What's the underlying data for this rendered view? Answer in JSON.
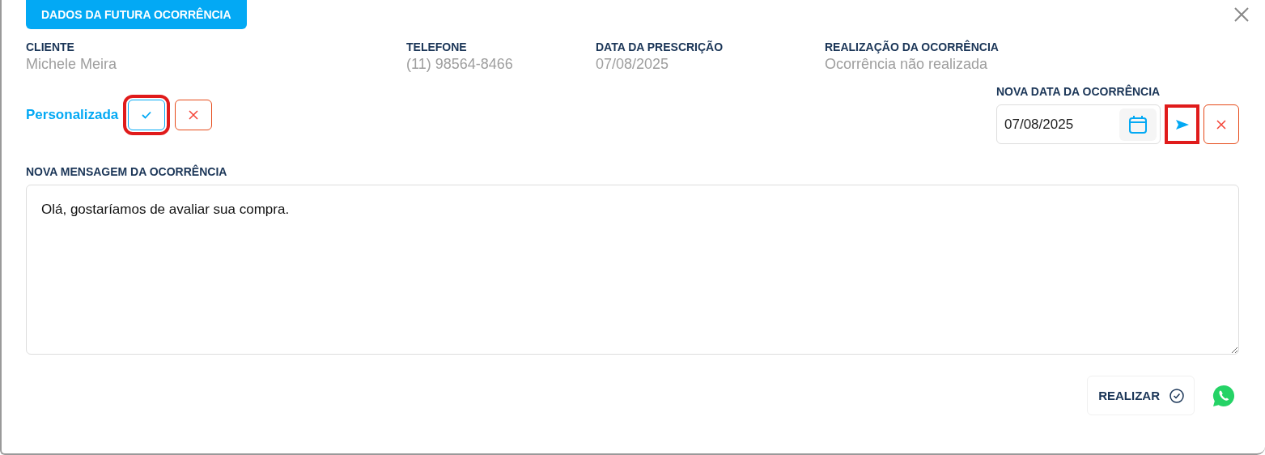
{
  "header_tab": {
    "label": "DADOS DA FUTURA OCORRÊNCIA"
  },
  "info": [
    {
      "label": "CLIENTE",
      "value": "Michele Meira"
    },
    {
      "label": "TELEFONE",
      "value": "(11) 98564-8466"
    },
    {
      "label": "DATA DA PRESCRIÇÃO",
      "value": "07/08/2025"
    },
    {
      "label": "REALIZAÇÃO DA OCORRÊNCIA",
      "value": "Ocorrência não realizada"
    }
  ],
  "personalizada": {
    "label": "Personalizada",
    "confirm_highlighted": true
  },
  "nova_data": {
    "label": "NOVA DATA DA OCORRÊNCIA",
    "value": "07/08/2025",
    "send_highlighted": true
  },
  "mensagem": {
    "label": "NOVA MENSAGEM DA OCORRÊNCIA",
    "value": "Olá, gostaríamos de avaliar sua compra."
  },
  "realizar_button": {
    "label": "REALIZAR"
  }
}
